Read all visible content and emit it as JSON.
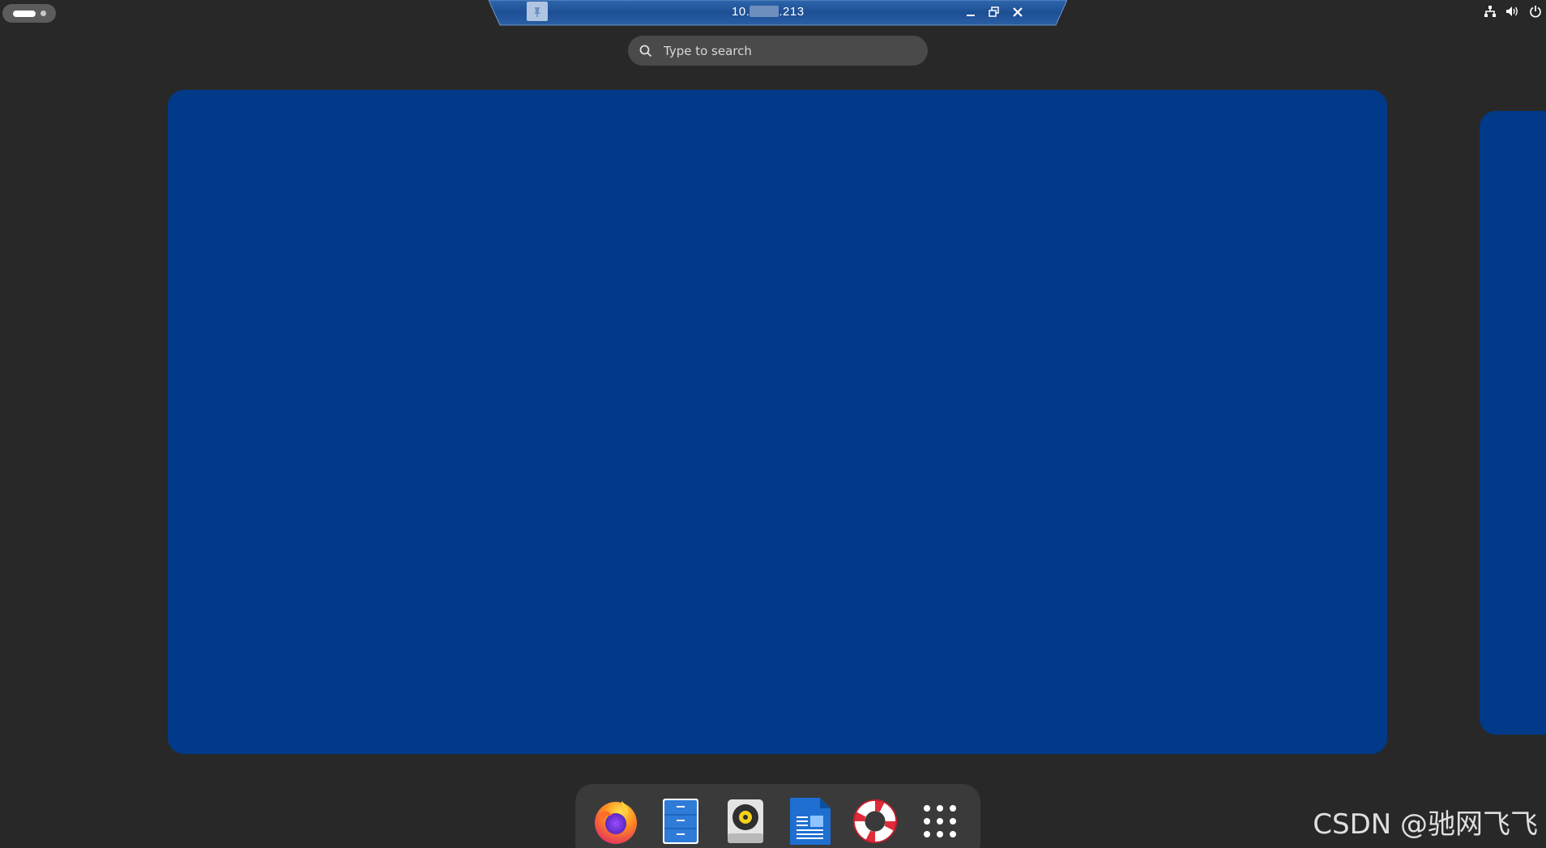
{
  "top_bar": {
    "activities_icon": "activities-pill"
  },
  "rdp_bar": {
    "title_start": "10.",
    "title_end": ".213",
    "pin_icon": "pin-icon",
    "minimize_icon": "minimize-icon",
    "restore_icon": "restore-icon",
    "close_icon": "close-icon",
    "bar_color": "#1d4f94"
  },
  "system_tray": {
    "icons": [
      "network-icon",
      "volume-icon",
      "power-icon"
    ]
  },
  "search": {
    "placeholder": "Type to search",
    "icon": "search-icon"
  },
  "workspaces": {
    "color": "#003a88"
  },
  "dock": {
    "apps": [
      {
        "name": "Firefox",
        "icon": "firefox-icon"
      },
      {
        "name": "Files",
        "icon": "files-icon"
      },
      {
        "name": "Rhythmbox",
        "icon": "rhythmbox-icon"
      },
      {
        "name": "LibreOffice Writer",
        "icon": "writer-icon"
      },
      {
        "name": "Help",
        "icon": "help-icon"
      },
      {
        "name": "Show Applications",
        "icon": "app-grid-icon"
      }
    ]
  },
  "watermark": "CSDN @驰网飞飞"
}
